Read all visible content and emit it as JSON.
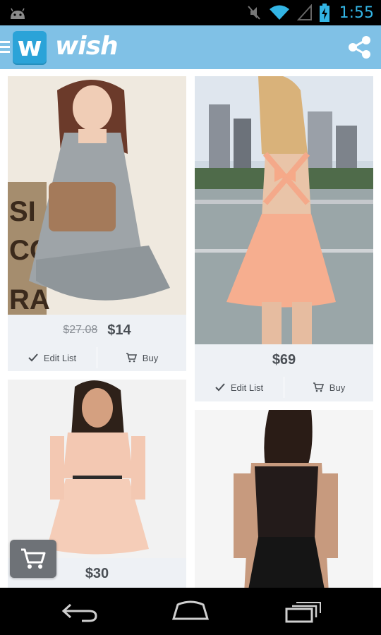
{
  "status_bar": {
    "time": "1:55",
    "icons": [
      "android-icon",
      "mute-icon",
      "wifi-icon",
      "signal-icon",
      "battery-charging-icon"
    ]
  },
  "app_bar": {
    "logo_letter": "w",
    "brand": "wish",
    "icons": [
      "menu-icon",
      "share-icon"
    ]
  },
  "products": [
    {
      "old_price": "$27.08",
      "price": "$14",
      "actions": [
        "Edit List",
        "Buy"
      ],
      "image": "gray-dress-photo"
    },
    {
      "price": "$69",
      "actions": [
        "Edit List",
        "Buy"
      ],
      "image": "peach-bow-dress-photo"
    },
    {
      "price": "$30",
      "image": "lace-peach-dress-photo"
    },
    {
      "image": "black-lace-dress-photo"
    }
  ],
  "cart_button": {
    "icon": "cart-icon"
  },
  "nav_bar": {
    "icons": [
      "back-icon",
      "home-icon",
      "recent-apps-icon"
    ]
  },
  "colors": {
    "app_bar": "#80c1e6",
    "logo": "#2ba3d8",
    "status_time": "#33b5e5",
    "card_bg": "#eef1f5"
  }
}
